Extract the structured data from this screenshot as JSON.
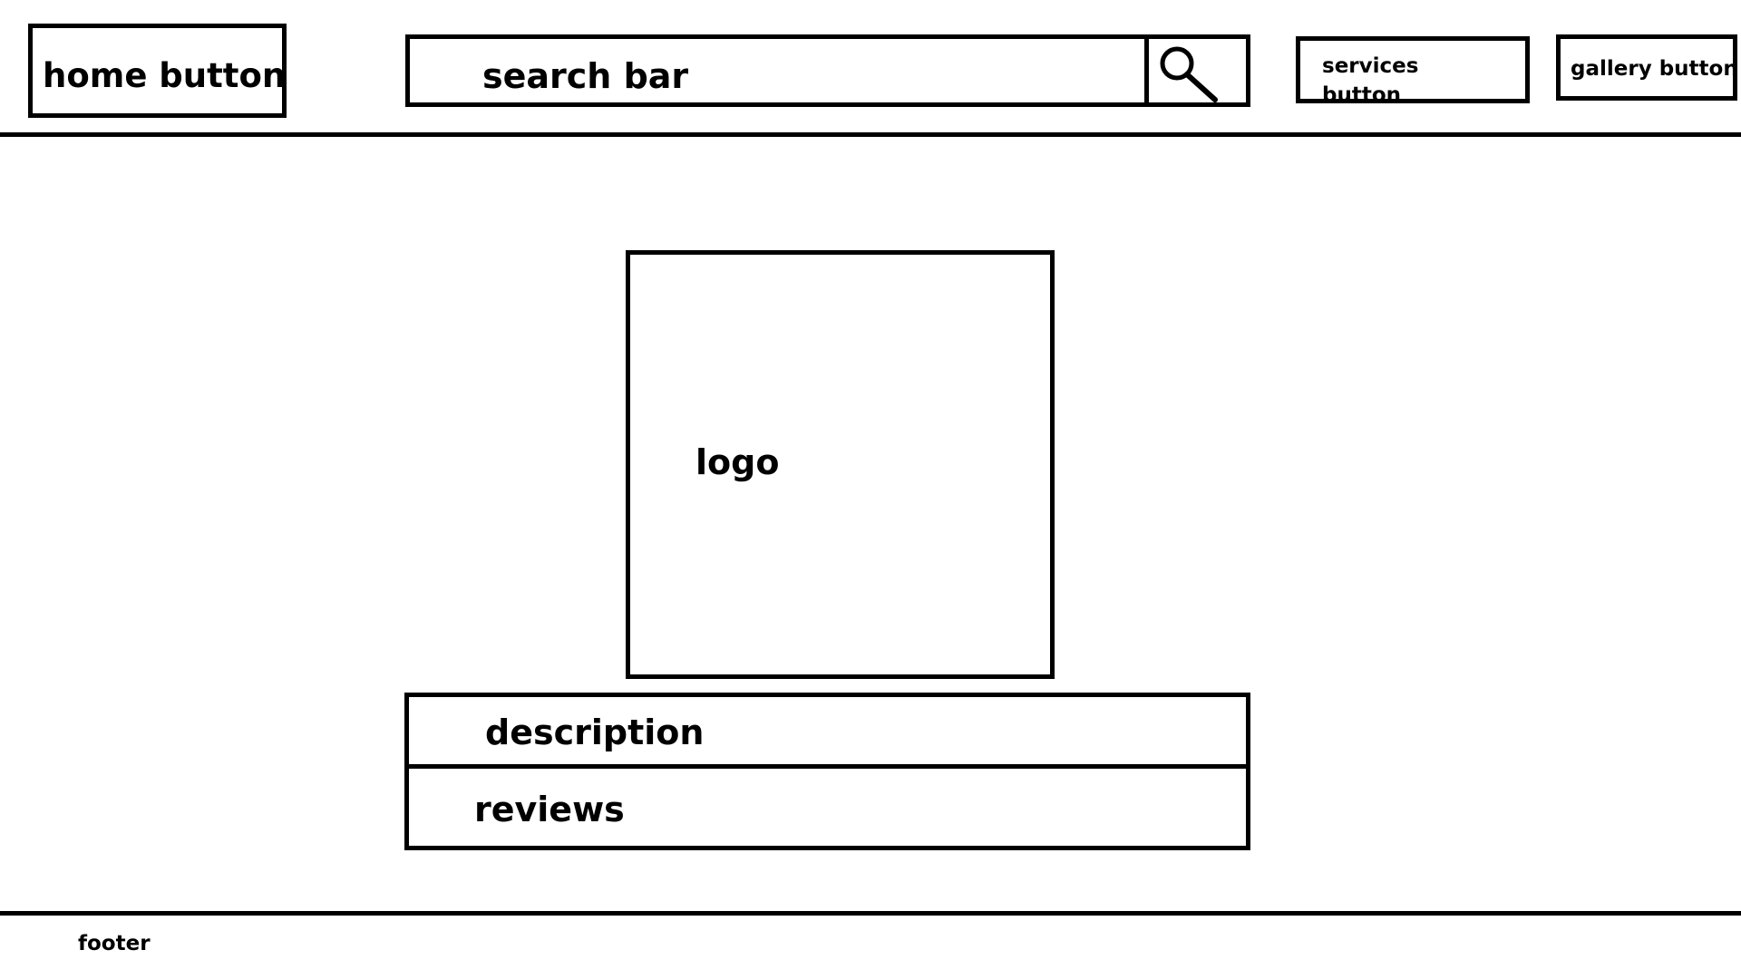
{
  "header": {
    "home_button": "home button",
    "search_bar": "search bar",
    "search_icon": "search-icon",
    "services_button": "services button",
    "gallery_button": "gallery button"
  },
  "main": {
    "logo": "logo",
    "description": "description",
    "reviews": "reviews"
  },
  "footer": {
    "text": "footer"
  },
  "colors": {
    "line": "#000000",
    "background": "#ffffff"
  }
}
